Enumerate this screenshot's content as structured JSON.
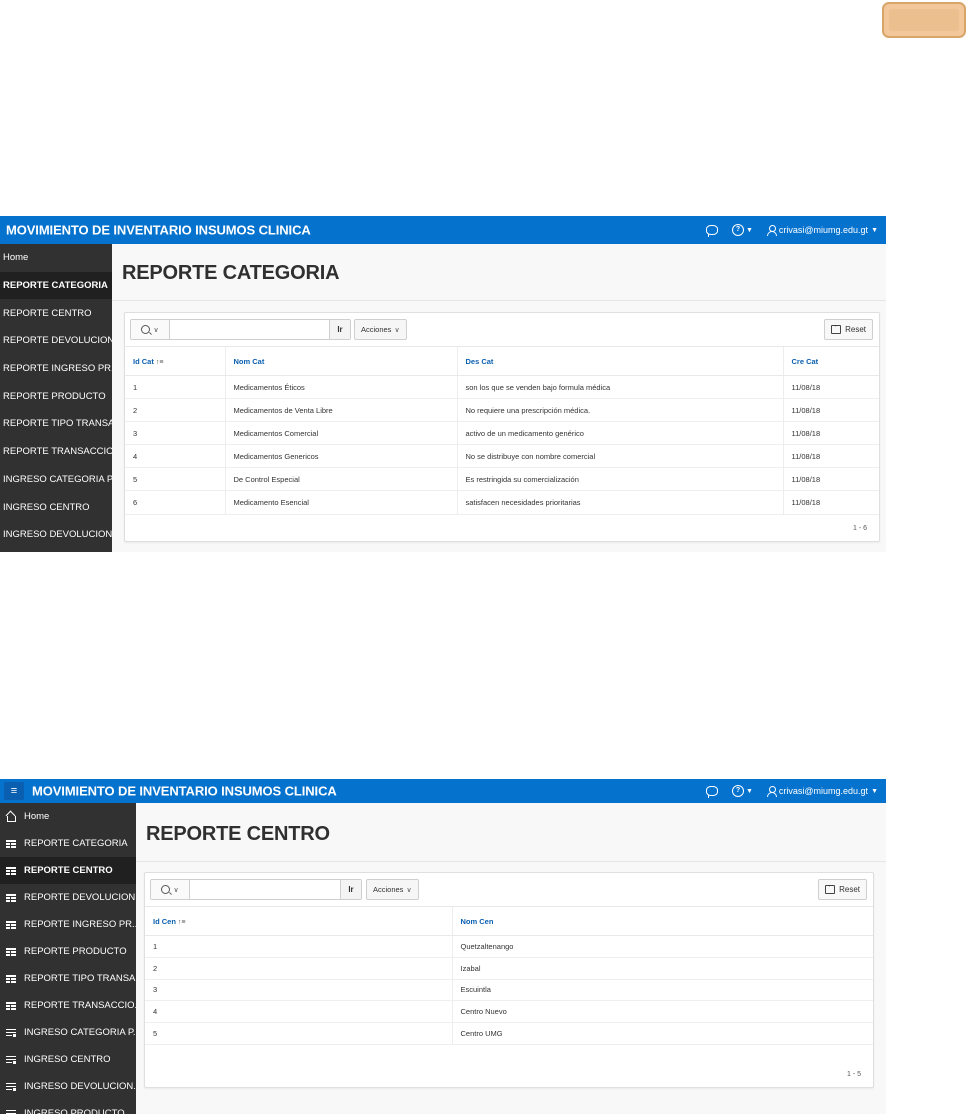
{
  "app_title": "MOVIMIENTO DE INVENTARIO INSUMOS CLINICA",
  "user": "crivasi@miumg.edu.gt",
  "help_glyph": "?",
  "hamburger_glyph": "≡",
  "caret_glyph": "▼",
  "toolbar": {
    "go_label": "Ir",
    "actions_label": "Acciones",
    "reset_label": "Reset"
  },
  "accent_color": "#0572ce",
  "shot1": {
    "page_title": "REPORTE CATEGORIA",
    "nav": [
      {
        "label": "Home"
      },
      {
        "label": "REPORTE CATEGORIA",
        "active": true
      },
      {
        "label": "REPORTE CENTRO"
      },
      {
        "label": "REPORTE DEVOLUCION..."
      },
      {
        "label": "REPORTE INGRESO PR..."
      },
      {
        "label": "REPORTE PRODUCTO"
      },
      {
        "label": "REPORTE TIPO TRANSA..."
      },
      {
        "label": "REPORTE TRANSACCIO..."
      },
      {
        "label": "INGRESO CATEGORIA P..."
      },
      {
        "label": "INGRESO CENTRO"
      },
      {
        "label": "INGRESO DEVOLUCION..."
      }
    ],
    "columns": [
      "Id Cat",
      "Nom Cat",
      "Des Cat",
      "Cre Cat"
    ],
    "rows": [
      [
        "1",
        "Medicamentos Éticos",
        "son los que se venden bajo formula médica",
        "11/08/18"
      ],
      [
        "2",
        "Medicamentos de Venta Libre",
        "No requiere una prescripción médica.",
        "11/08/18"
      ],
      [
        "3",
        "Medicamentos Comercial",
        "activo de un medicamento genérico",
        "11/08/18"
      ],
      [
        "4",
        "Medicamentos Genericos",
        "No se distribuye con nombre comercial",
        "11/08/18"
      ],
      [
        "5",
        "De Control Especial",
        "Es restringida su comercialización",
        "11/08/18"
      ],
      [
        "6",
        "Medicamento Esencial",
        "satisfacen necesidades prioritarias",
        "11/08/18"
      ]
    ],
    "pagination": "1 - 6"
  },
  "shot2": {
    "page_title": "REPORTE CENTRO",
    "nav": [
      {
        "label": "Home",
        "icon": "home-icon"
      },
      {
        "label": "REPORTE CATEGORIA",
        "icon": "table-icon"
      },
      {
        "label": "REPORTE CENTRO",
        "icon": "table-icon",
        "active": true
      },
      {
        "label": "REPORTE DEVOLUCION...",
        "icon": "table-icon"
      },
      {
        "label": "REPORTE INGRESO PR...",
        "icon": "table-icon"
      },
      {
        "label": "REPORTE PRODUCTO",
        "icon": "table-icon"
      },
      {
        "label": "REPORTE TIPO TRANSA...",
        "icon": "table-icon"
      },
      {
        "label": "REPORTE TRANSACCIO...",
        "icon": "table-icon"
      },
      {
        "label": "INGRESO CATEGORIA P...",
        "icon": "form-icon"
      },
      {
        "label": "INGRESO CENTRO",
        "icon": "form-icon"
      },
      {
        "label": "INGRESO DEVOLUCION...",
        "icon": "form-icon"
      },
      {
        "label": "INGRESO PRODUCTO",
        "icon": "form-icon"
      }
    ],
    "columns": [
      "Id Cen",
      "Nom Cen"
    ],
    "rows": [
      [
        "1",
        "Quetzaltenango"
      ],
      [
        "2",
        "Izabal"
      ],
      [
        "3",
        "Escuintla"
      ],
      [
        "4",
        "Centro Nuevo"
      ],
      [
        "5",
        "Centro UMG"
      ]
    ],
    "pagination": "1 - 5"
  }
}
